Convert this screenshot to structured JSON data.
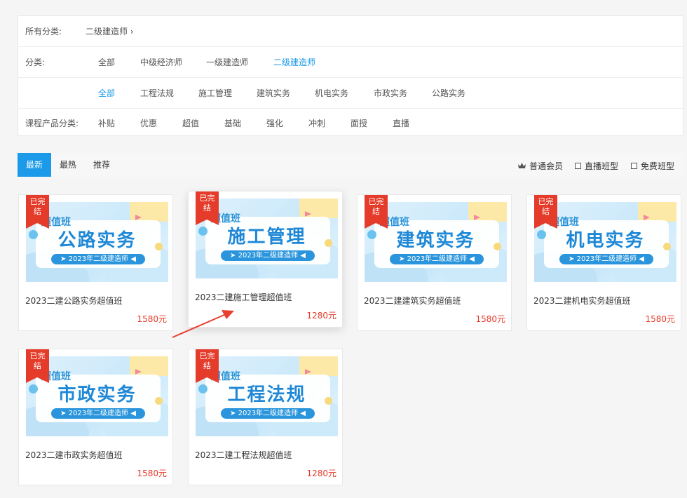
{
  "filters": {
    "all_label": "所有分类:",
    "breadcrumb": "二级建造师 ›",
    "category_label": "分类:",
    "categories": [
      "全部",
      "中级经济师",
      "一级建造师",
      "二级建造师"
    ],
    "subjects": [
      "全部",
      "工程法规",
      "施工管理",
      "建筑实务",
      "机电实务",
      "市政实务",
      "公路实务"
    ],
    "product_label": "课程产品分类:",
    "products": [
      "补贴",
      "优惠",
      "超值",
      "基础",
      "强化",
      "冲刺",
      "面授",
      "直播"
    ]
  },
  "sortbar": {
    "tabs": [
      "最新",
      "最热",
      "推荐"
    ],
    "member_label": "普通会员",
    "checks": [
      "直播班型",
      "免费班型"
    ]
  },
  "thumb": {
    "tag": "超值班",
    "pill": "➤ 2023年二级建造师 ◀",
    "ribbon": "已完结"
  },
  "courses": [
    {
      "subject": "公路实务",
      "title": "2023二建公路实务超值班",
      "price": "1580元"
    },
    {
      "subject": "施工管理",
      "title": "2023二建施工管理超值班",
      "price": "1280元"
    },
    {
      "subject": "建筑实务",
      "title": "2023二建建筑实务超值班",
      "price": "1580元"
    },
    {
      "subject": "机电实务",
      "title": "2023二建机电实务超值班",
      "price": "1580元"
    },
    {
      "subject": "市政实务",
      "title": "2023二建市政实务超值班",
      "price": "1580元"
    },
    {
      "subject": "工程法规",
      "title": "2023二建工程法规超值班",
      "price": "1280元"
    }
  ],
  "colors": {
    "accent": "#1a9ae8",
    "price": "#e53b2a",
    "annotation_arrow": "#e8402e"
  }
}
